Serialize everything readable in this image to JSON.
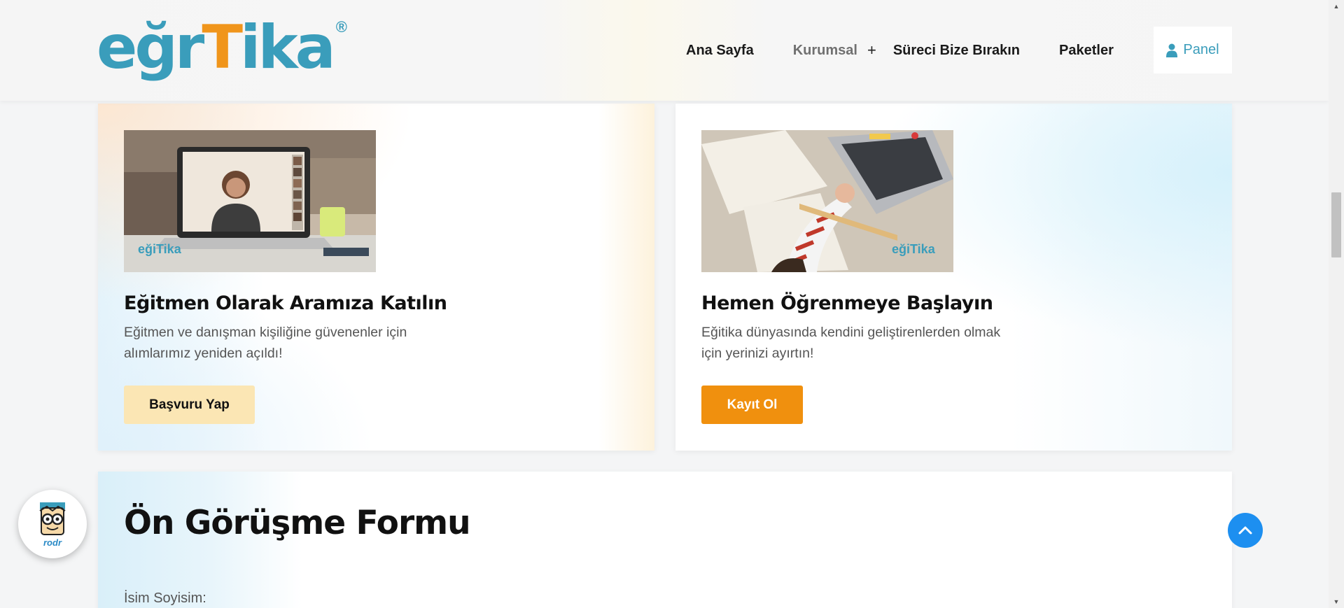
{
  "header": {
    "logo_text_a": "eğr",
    "logo_text_t": "T",
    "logo_text_b": "ika",
    "logo_reg": "®",
    "nav": [
      {
        "label": "Ana Sayfa"
      },
      {
        "label": "Kurumsal"
      },
      {
        "label": "Süreci Bize Bırakın"
      },
      {
        "label": "Paketler"
      }
    ],
    "panel_label": "Panel"
  },
  "cards": [
    {
      "title": "Eğitmen Olarak Aramıza Katılın",
      "desc": "Eğitmen ve danışman kişiliğine güvenenler için alımlarımız yeniden açıldı!",
      "button": "Başvuru Yap",
      "img_watermark": "eğiTika"
    },
    {
      "title": "Hemen Öğrenmeye Başlayın",
      "desc": "Eğitika dünyasında kendini geliştirenlerden olmak için yerinizi ayırtın!",
      "button": "Kayıt Ol",
      "img_watermark": "eğiTika"
    }
  ],
  "form": {
    "title": "Ön Görüşme Formu",
    "name_label": "İsim Soyisim:"
  },
  "chat_bot": {
    "label": "rodr"
  },
  "colors": {
    "brand_blue": "#3a9dbb",
    "brand_orange": "#f0900e",
    "apply_bg": "#fbe6b4",
    "scroll_top_bg": "#1d8ff0"
  }
}
